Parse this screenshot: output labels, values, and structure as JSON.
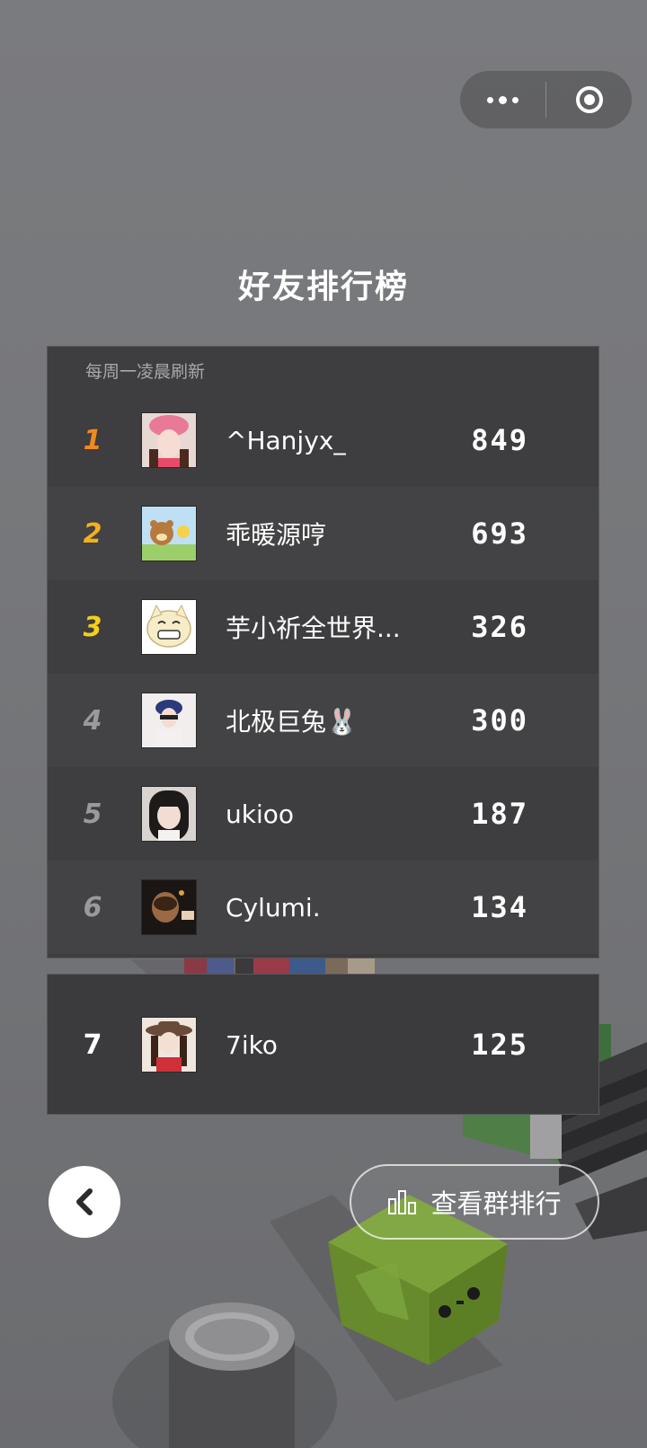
{
  "header": {
    "more_icon": "more-dots-icon",
    "close_icon": "target-circle-icon"
  },
  "title": "好友排行榜",
  "subtitle": "每周一凌晨刷新",
  "colors": {
    "rank1": "#f0891e",
    "rank2": "#f4b01c",
    "rank3": "#f4cf1c",
    "rank_other": "#9a9a9a"
  },
  "leaderboard": [
    {
      "rank": "1",
      "name": "^Hanjyx_",
      "score": "849"
    },
    {
      "rank": "2",
      "name": "乖暖源哼",
      "score": "693"
    },
    {
      "rank": "3",
      "name": "芋小祈全世界...",
      "score": "326"
    },
    {
      "rank": "4",
      "name": "北极巨兔🐰",
      "score": "300"
    },
    {
      "rank": "5",
      "name": "ukioo",
      "score": "187"
    },
    {
      "rank": "6",
      "name": "Cylumi.",
      "score": "134"
    }
  ],
  "me": {
    "rank": "7",
    "name": "7iko",
    "score": "125"
  },
  "buttons": {
    "back_icon": "chevron-left-icon",
    "group_rank_label": "查看群排行",
    "group_rank_icon": "bar-chart-icon"
  }
}
